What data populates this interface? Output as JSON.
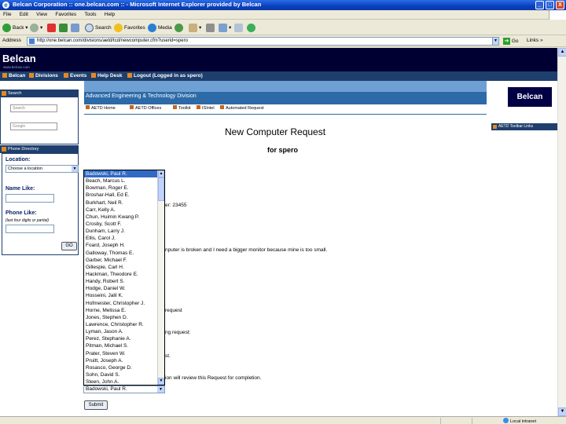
{
  "window": {
    "title": "Belcan Corporation :: one.belcan.com :: - Microsoft Internet Explorer provided by Belcan",
    "buttons": [
      "_",
      "□",
      "X"
    ]
  },
  "menu": [
    "File",
    "Edit",
    "View",
    "Favorites",
    "Tools",
    "Help"
  ],
  "toolbar": {
    "back": "Back",
    "search": "Search",
    "favorites": "Favorites",
    "media": "Media"
  },
  "address": {
    "label": "Address",
    "url": "http://one.belcan.com/divisions/aetd/tcd/newcomputer.cfm?userid=spero",
    "go": "Go",
    "links": "Links »"
  },
  "site": {
    "logo": "Belcan",
    "logo_sub": "www.belcan.com",
    "nav": [
      "Belcan",
      "Divisions",
      "Events",
      "Help Desk",
      "Logout (Logged in as spero)"
    ]
  },
  "search_panel": {
    "header": "Search",
    "input1_placeholder": "Search",
    "input2_placeholder": "Google"
  },
  "phone_dir": {
    "header": "Phone Directory",
    "location_label": "Location:",
    "location_value": "Choose a location",
    "name_label": "Name Like:",
    "phone_label": "Phone Like:",
    "phone_hint": "(last four digits or partial)",
    "go_label": "GO"
  },
  "division": {
    "name": "Advanced Engineering & Technology Division",
    "brand": "Belcan",
    "nav": [
      "AETD Home",
      "AETD Offices",
      "Toolkit",
      "ISIntel",
      "Automated Request"
    ],
    "right_link": "AETD Toolbar Links"
  },
  "form": {
    "title": "New Computer Request",
    "subtitle": "for spero",
    "submit_label": "Submit",
    "fragments": {
      "number": "er: 23455",
      "reason": "nputer is broken and I need a bigger monitor because mine is too small.",
      "request": "request",
      "pending": "ng request:",
      "st": "st.",
      "review": "ion will review this Request for completion."
    }
  },
  "approver_list": {
    "selected_index": 0,
    "items": [
      "Badowski, Paul R.",
      "Beach, Marcus L.",
      "Bowman, Roger E.",
      "Broshar-Hall, Ed E.",
      "Burkhart, Neil R.",
      "Carr, Kelly A.",
      "Chun, Huimin Kwang P.",
      "Crosby, Scott F.",
      "Dunham, Larry J.",
      "Ellis, Carol J.",
      "Foard, Joseph H.",
      "Galloway, Thomas E.",
      "Garber, Michael F.",
      "Gillespie, Carl H.",
      "Hackman, Theodore E.",
      "Handy, Robert S.",
      "Hodge, Daniel W.",
      "Hosseini, Jalil K.",
      "Hofmeister, Christopher J.",
      "Horne, Melissa E.",
      "Jones, Stephen D.",
      "Lawrence, Christopher R.",
      "Lyman, Jason A.",
      "Perez, Stephanie A.",
      "Pitman, Michael S.",
      "Prater, Steven W.",
      "Pruitt, Joseph A.",
      "Rosasco, George D.",
      "Sohn, David S.",
      "Steen, John A."
    ],
    "closed_value": "Badowski, Paul R."
  },
  "status": {
    "zone": "Local intranet"
  }
}
